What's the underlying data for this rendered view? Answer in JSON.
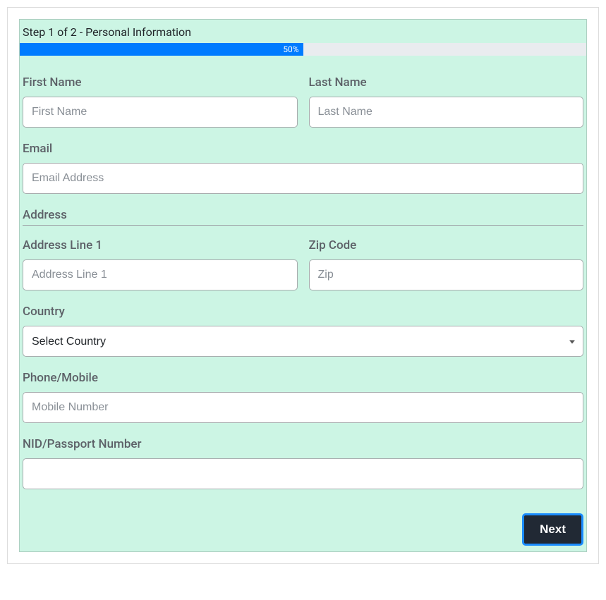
{
  "step_header": "Step 1 of 2 - Personal Information",
  "progress": {
    "label": "50%",
    "percent": 50
  },
  "fields": {
    "first_name": {
      "label": "First Name",
      "placeholder": "First Name"
    },
    "last_name": {
      "label": "Last Name",
      "placeholder": "Last Name"
    },
    "email": {
      "label": "Email",
      "placeholder": "Email Address"
    },
    "address_section": "Address",
    "address_line1": {
      "label": "Address Line 1",
      "placeholder": "Address Line 1"
    },
    "zip": {
      "label": "Zip Code",
      "placeholder": "Zip"
    },
    "country": {
      "label": "Country",
      "selected": "Select Country"
    },
    "phone": {
      "label": "Phone/Mobile",
      "placeholder": "Mobile Number"
    },
    "nid": {
      "label": "NID/Passport Number",
      "placeholder": ""
    }
  },
  "buttons": {
    "next": "Next"
  }
}
